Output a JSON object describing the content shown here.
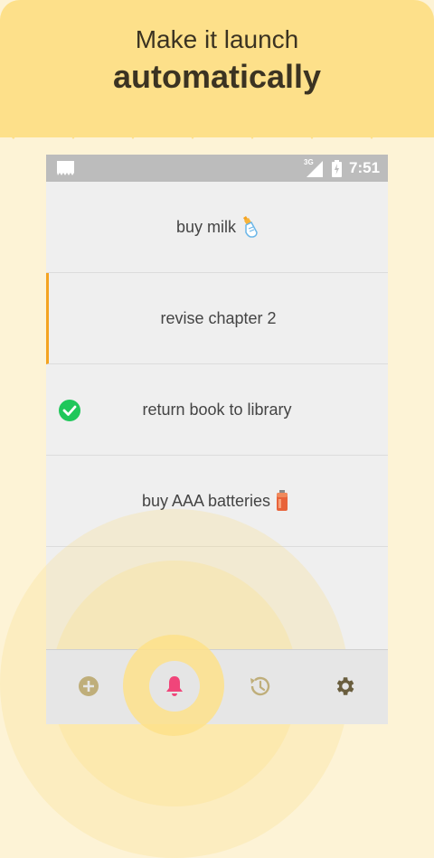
{
  "headline": {
    "line1": "Make it launch",
    "line2": "automatically"
  },
  "status_bar": {
    "network": "3G",
    "time": "7:51"
  },
  "tasks": [
    {
      "text": "buy milk",
      "icon": "baby-bottle-icon"
    },
    {
      "text": "revise chapter 2",
      "state": "active"
    },
    {
      "text": "return book to library",
      "state": "done",
      "icon": "check-circle-icon"
    },
    {
      "text": "buy AAA batteries",
      "icon": "battery-icon"
    }
  ],
  "bottom_nav": [
    {
      "icon": "add-icon"
    },
    {
      "icon": "bell-icon",
      "state": "selected"
    },
    {
      "icon": "history-icon"
    },
    {
      "icon": "settings-icon"
    }
  ],
  "colors": {
    "banner": "#fde08a",
    "background": "#fdf3d6",
    "accent": "#f4a320",
    "bell": "#f0457a",
    "check": "#1fc75a",
    "nav_icon": "#bfae7a"
  }
}
